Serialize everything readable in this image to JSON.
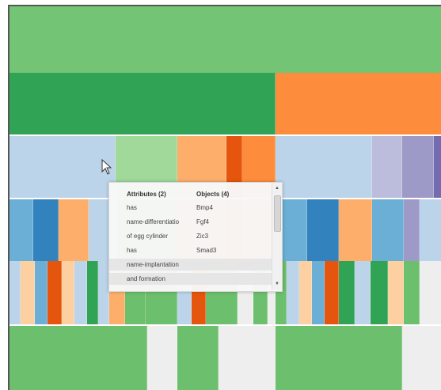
{
  "colors": {
    "green_light": "#74c476",
    "green_mid": "#6cbf6c",
    "green_dark": "#31a354",
    "green_pale": "#a1d99b",
    "orange": "#fd8d3c",
    "orange_light": "#fdae6b",
    "orange_dark": "#e6550d",
    "peach": "#fdd0a2",
    "blue_light": "#bcd4e9",
    "blue_mid": "#6baed6",
    "blue_dark": "#3182bd",
    "purple_light": "#bcbddc",
    "purple": "#9e9ac8",
    "purple_dark": "#756bb1",
    "gray_light": "#eeeeee"
  },
  "cursor_icon": "mouse-pointer-icon",
  "tooltip": {
    "header": {
      "attributes": "Attributes (2)",
      "objects": "Objects (4)"
    },
    "rows": [
      {
        "attribute": "has",
        "object": "Bmp4"
      },
      {
        "attribute": "name-differentiatio",
        "object": "Fgf4"
      },
      {
        "attribute": "of egg cylinder",
        "object": "Zic3"
      },
      {
        "attribute": "has",
        "object": "Smad3"
      },
      {
        "attribute": "name-implantation",
        "object": ""
      },
      {
        "attribute": "and formation",
        "object": ""
      }
    ],
    "scroll_up_icon": "arrow-up-icon",
    "scroll_down_icon": "arrow-down-icon"
  }
}
